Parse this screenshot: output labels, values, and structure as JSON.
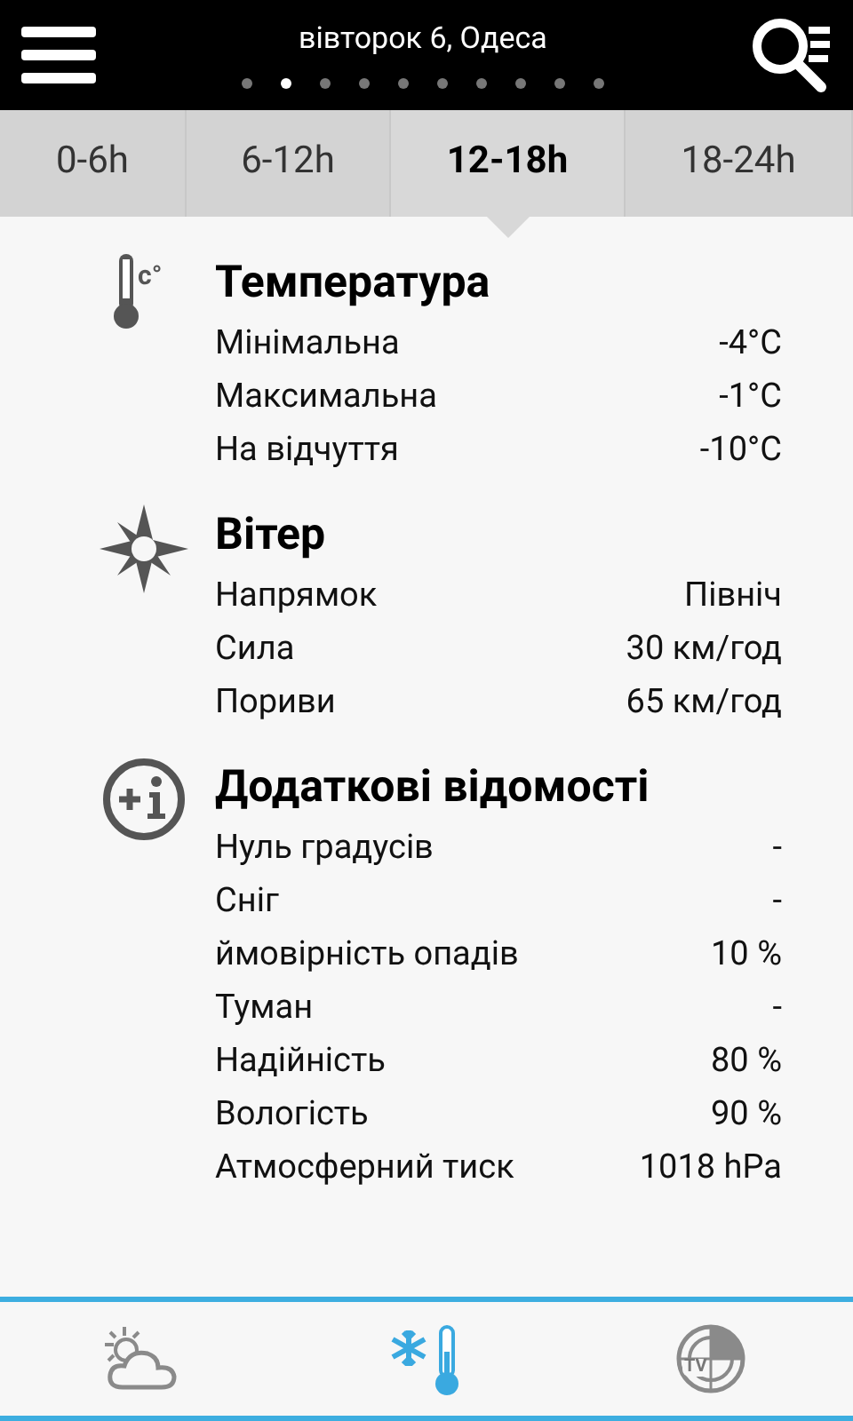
{
  "header": {
    "title": "вівторок 6, Одеса",
    "pages": [
      {
        "selected": false
      },
      {
        "selected": true
      },
      {
        "selected": false
      },
      {
        "selected": false
      },
      {
        "selected": false
      },
      {
        "selected": false
      },
      {
        "selected": false
      },
      {
        "selected": false
      },
      {
        "selected": false
      },
      {
        "selected": false
      }
    ]
  },
  "tabs": [
    {
      "label": "0-6h",
      "selected": false
    },
    {
      "label": "6-12h",
      "selected": false
    },
    {
      "label": "12-18h",
      "selected": true
    },
    {
      "label": "18-24h",
      "selected": false
    }
  ],
  "sections": [
    {
      "kind": "temperature",
      "icon_text": "c°",
      "title": "Температура",
      "rows": [
        {
          "label": "Мінімальна",
          "value": "-4°C"
        },
        {
          "label": "Максимальна",
          "value": "-1°C"
        },
        {
          "label": "На відчуття",
          "value": "-10°C"
        }
      ]
    },
    {
      "kind": "wind",
      "title": "Вітер",
      "rows": [
        {
          "label": "Напрямок",
          "value": "Північ"
        },
        {
          "label": "Сила",
          "value": "30 км/год"
        },
        {
          "label": "Пориви",
          "value": "65 км/год"
        }
      ]
    },
    {
      "kind": "info",
      "title": "Додаткові відомості",
      "rows": [
        {
          "label": "Нуль градусів",
          "value": "-"
        },
        {
          "label": "Сніг",
          "value": "-"
        },
        {
          "label": "ймовірність опадів",
          "value": "10 %"
        },
        {
          "label": "Туман",
          "value": "-"
        },
        {
          "label": "Надійність",
          "value": "80 %"
        },
        {
          "label": "Вологість",
          "value": "90 %"
        },
        {
          "label": "Атмосферний тиск",
          "value": "1018 hPa"
        }
      ]
    }
  ],
  "bottom_nav": [
    {
      "kind": "forecast",
      "selected": false
    },
    {
      "kind": "temperature",
      "selected": true
    },
    {
      "kind": "radar",
      "badge": "TV",
      "selected": false
    }
  ]
}
